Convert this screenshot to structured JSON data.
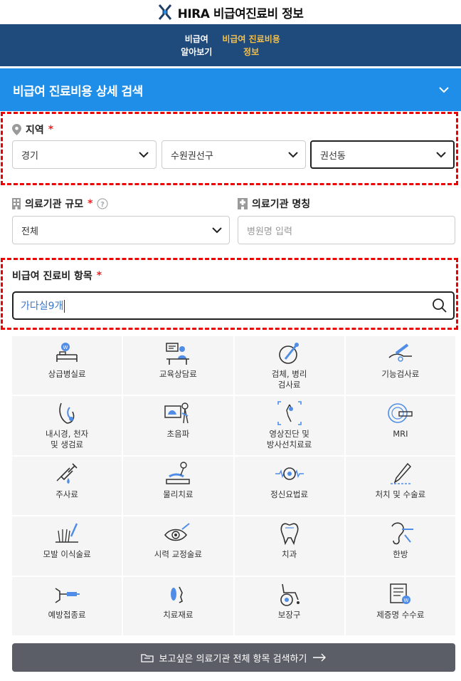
{
  "header": {
    "title": "HIRA 비급여진료비 정보"
  },
  "nav": {
    "items": [
      {
        "label": "비급여\n알아보기"
      },
      {
        "label": "비급여 진료비용\n정보"
      }
    ]
  },
  "search_section": {
    "title": "비급여 진료비용 상세 검색"
  },
  "region": {
    "label": "지역",
    "required_mark": "*",
    "province": "경기",
    "district": "수원권선구",
    "dong": "권선동"
  },
  "facility_size": {
    "label": "의료기관 규모",
    "required_mark": "*",
    "value": "전체"
  },
  "facility_name": {
    "label": "의료기관 명칭",
    "placeholder": "병원명 입력"
  },
  "item": {
    "label": "비급여 진료비 항목",
    "required_mark": "*",
    "value": "가다실9개"
  },
  "categories": [
    {
      "label": "상급병실료",
      "icon": "hospital-bed-icon"
    },
    {
      "label": "교육상담료",
      "icon": "consultation-icon"
    },
    {
      "label": "검체, 병리\n검사료",
      "icon": "specimen-test-icon"
    },
    {
      "label": "기능검사료",
      "icon": "function-test-icon"
    },
    {
      "label": "내시경, 천자\n및 생검료",
      "icon": "endoscope-icon"
    },
    {
      "label": "초음파",
      "icon": "ultrasound-icon"
    },
    {
      "label": "영상진단 및\n방사선치료료",
      "icon": "imaging-icon"
    },
    {
      "label": "MRI",
      "icon": "mri-icon"
    },
    {
      "label": "주사료",
      "icon": "injection-icon"
    },
    {
      "label": "물리치료",
      "icon": "physical-therapy-icon"
    },
    {
      "label": "정신요법료",
      "icon": "psychotherapy-icon"
    },
    {
      "label": "처치 및 수술료",
      "icon": "surgery-icon"
    },
    {
      "label": "모발 이식술료",
      "icon": "hair-transplant-icon"
    },
    {
      "label": "시력 교정술료",
      "icon": "vision-correction-icon"
    },
    {
      "label": "치과",
      "icon": "tooth-icon"
    },
    {
      "label": "한방",
      "icon": "oriental-medicine-icon"
    },
    {
      "label": "예방접종료",
      "icon": "vaccination-icon"
    },
    {
      "label": "치료재료",
      "icon": "treatment-material-icon"
    },
    {
      "label": "보장구",
      "icon": "wheelchair-icon"
    },
    {
      "label": "제증명 수수료",
      "icon": "certificate-icon"
    }
  ],
  "bottom_button": {
    "label": "보고싶은 의료기관 전체 항목 검색하기"
  },
  "colors": {
    "nav_bg": "#1f4a7c",
    "accent_blue": "#1e8ee8",
    "active_nav": "#f5c14b",
    "highlight_border": "#e00000"
  }
}
